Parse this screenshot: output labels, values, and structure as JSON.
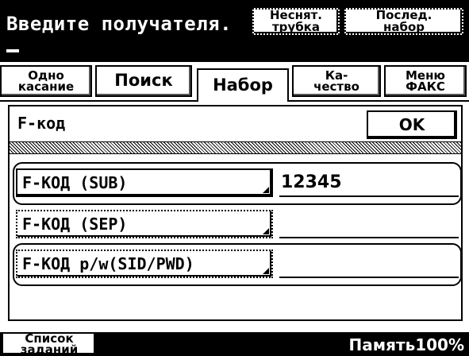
{
  "header": {
    "prompt": "Введите получателя.",
    "onhook_line1": "Неснят.",
    "onhook_line2": "трубка",
    "redial_line1": "Послед.",
    "redial_line2": "набор"
  },
  "tabs": {
    "one_touch_line1": "Одно",
    "one_touch_line2": "касание",
    "search": "Поиск",
    "dial": "Набор",
    "quality_line1": "Ка-",
    "quality_line2": "чество",
    "fax_menu_line1": "Меню",
    "fax_menu_line2": "ФАКС"
  },
  "panel": {
    "title": "F-код",
    "ok_label": "OK",
    "rows": [
      {
        "label": "F-КОД (SUB)",
        "value": "12345"
      },
      {
        "label": "F-КОД (SEP)",
        "value": ""
      },
      {
        "label": "F-КОД p/w(SID/PWD)",
        "value": ""
      }
    ]
  },
  "status": {
    "job_list_line1": "Список",
    "job_list_line2": "заданий",
    "memory": "Память100%"
  }
}
